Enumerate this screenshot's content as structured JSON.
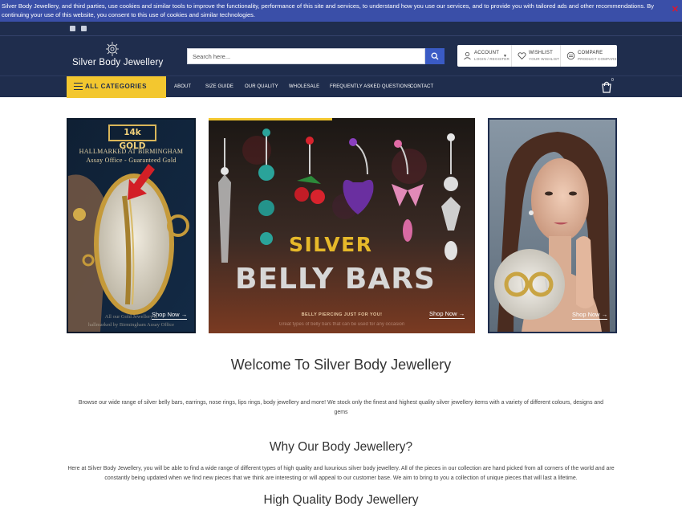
{
  "cookie": {
    "text": "Silver Body Jewellery, and third parties, use cookies and similar tools to improve the functionality, performance of this site and services, to understand how you use our services, and to provide you with tailored ads and other recommendations. By continuing your use of this website, you consent to this use of cookies and similar technologies.",
    "close": "✕"
  },
  "header": {
    "logo_text": "Silver Body Jewellery",
    "search_placeholder": "Search here...",
    "account": {
      "title": "ACCOUNT",
      "sub": "LOGIN / REGISTER"
    },
    "wishlist": {
      "title": "WISHLIST",
      "sub": "YOUR WISHLIST"
    },
    "compare": {
      "title": "COMPARE",
      "sub": "PRODUCT COMPARE"
    }
  },
  "nav": {
    "all_categories": "ALL CATEGORIES",
    "links": [
      "ABOUT",
      "SIZE GUIDE",
      "OUR QUALITY",
      "WHOLESALE",
      "FREQUENTLY ASKED QUESTIONS",
      "CONTACT"
    ],
    "cart_count": "0"
  },
  "banners": {
    "left": {
      "badge": "14k GOLD",
      "line1": "HALLMARKED AT BIRMINGHAM",
      "line2": "Assay Office - Guaranteed Gold",
      "foot1": "All our Gold Jewellery is",
      "foot2": "hallmarked by Birmingham Assay Office",
      "shop": "Shop Now"
    },
    "middle": {
      "headline1": "SILVER",
      "headline2": "BELLY BARS",
      "tag": "BELLY PIERCING JUST FOR YOU!",
      "fine": "Great types of belly bars that can be used for any occasion",
      "shop": "Shop Now"
    },
    "right": {
      "shop": "Shop Now"
    }
  },
  "content": {
    "welcome": "Welcome To Silver Body Jewellery",
    "para1": "Browse our wide range of silver belly bars, earrings, nose rings, lips rings, body jewellery and more! We stock only the finest and highest quality silver jewellery items with a variety of different colours, designs and gems",
    "why_heading": "Why Our Body Jewellery?",
    "para2": "Here at Silver Body Jewellery, you will be able to find a wide range of different types of high quality and luxurious silver body jewellery. All of the pieces in our collection are hand picked from all corners of the world and are constantly being updated when we find new pieces that we think are interesting or will appeal to our customer base. We aim to bring to you a collection of unique pieces that will last a lifetime.",
    "high_heading": "High Quality Body Jewellery"
  },
  "colors": {
    "navy": "#1f2d4d",
    "accent_yellow": "#f3c72f",
    "search_blue": "#3a5bc5",
    "cookie_blue": "#3a4fa8"
  },
  "icons": [
    "facebook-icon",
    "instagram-icon",
    "search-icon",
    "user-icon",
    "heart-icon",
    "compare-icon",
    "menu-icon",
    "cart-icon",
    "arrow-right-icon",
    "close-icon"
  ]
}
